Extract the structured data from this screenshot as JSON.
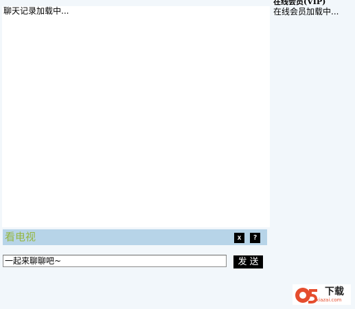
{
  "chat": {
    "loading_text": "聊天记录加载中..."
  },
  "members": {
    "title": "在线会员(VIP)",
    "loading_text": "在线会员加载中..."
  },
  "tv_bar": {
    "label": "看电视",
    "close_label": "x",
    "help_label": "?"
  },
  "composer": {
    "input_value": "一起来聊聊吧~",
    "send_label": "发送"
  },
  "watermark": {
    "brand_text": "下载",
    "url_text": "xiazai.com",
    "brand_color": "#e54d2e"
  }
}
